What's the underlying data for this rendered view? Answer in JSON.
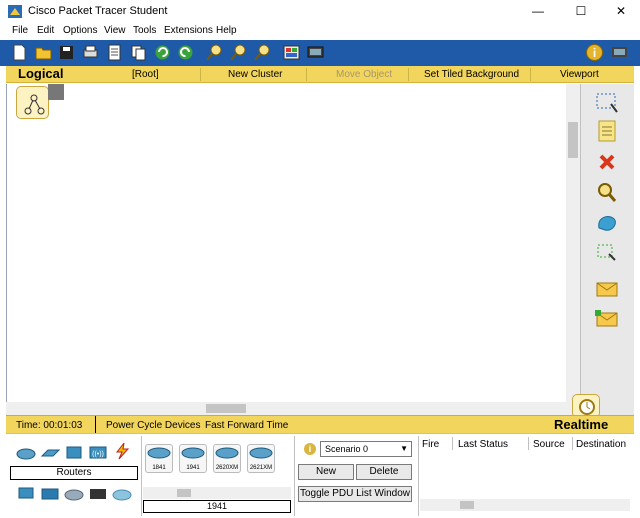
{
  "window": {
    "title": "Cisco Packet Tracer Student",
    "minimize": "—",
    "maximize": "☐",
    "close": "✕"
  },
  "menu": [
    "File",
    "Edit",
    "Options",
    "View",
    "Tools",
    "Extensions",
    "Help"
  ],
  "toolbar": {
    "icons": [
      "new-file-icon",
      "open-folder-icon",
      "save-icon",
      "print-icon",
      "activity-wizard-icon",
      "copy-icon",
      "undo-icon",
      "redo-icon",
      "zoom-in-icon",
      "zoom-reset-icon",
      "zoom-out-icon",
      "palette-icon",
      "custom-device-icon"
    ],
    "help_icon": "help-icon"
  },
  "workspace_bar": {
    "mode": "Logical",
    "items": [
      "[Root]",
      "New Cluster",
      "Move Object",
      "Set Tiled Background",
      "Viewport"
    ]
  },
  "right_panel": {
    "tools": [
      "select-icon",
      "note-icon",
      "delete-icon",
      "inspect-icon",
      "draw-shape-icon",
      "resize-shape-icon",
      "add-simple-pdu-icon",
      "add-complex-pdu-icon"
    ]
  },
  "status": {
    "time": "Time: 00:01:03",
    "power_cycle": "Power Cycle Devices",
    "fast_forward": "Fast Forward Time",
    "mode": "Realtime"
  },
  "device_categories": {
    "selected": "Routers",
    "icons": [
      "routers-icon",
      "switches-icon",
      "hubs-icon",
      "wireless-icon",
      "connections-icon",
      "end-devices-icon",
      "wan-emulation-icon",
      "custom-devices-icon",
      "multiuser-icon",
      "security-icon"
    ]
  },
  "devices": {
    "list": [
      "1841",
      "1941",
      "2620XM",
      "2621XM"
    ],
    "selected_name": "1941"
  },
  "scenario": {
    "selected": "Scenario 0",
    "new_label": "New",
    "delete_label": "Delete",
    "toggle_label": "Toggle PDU List Window"
  },
  "pdu_table": {
    "columns": [
      "Fire",
      "Last Status",
      "Source",
      "Destination"
    ]
  },
  "colors": {
    "toolbar": "#1e5aa8",
    "workspace_bar": "#f2d55c",
    "status_bar": "#f2d55c"
  }
}
